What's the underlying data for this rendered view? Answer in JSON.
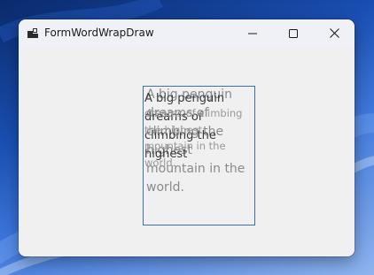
{
  "window": {
    "title": "FormWordWrapDraw",
    "icon": "app-window-icon",
    "controls": {
      "minimize_icon": "minimize-icon",
      "maximize_icon": "maximize-icon",
      "close_icon": "close-icon"
    }
  },
  "canvas": {
    "drawn_text_large": "A big penguin dreams of climbing the highest mountain in the world.",
    "drawn_text_medium": "A big penguin dreams of climbing the highest",
    "drawn_text_small": "dreams of climbing the highest mountain in the world.",
    "rect_color": "#3b6fb0"
  },
  "colors": {
    "window_bg": "#f0f0f0",
    "titlebar_bg": "#eff1f7",
    "desktop_accent": "#1a4fb3"
  }
}
